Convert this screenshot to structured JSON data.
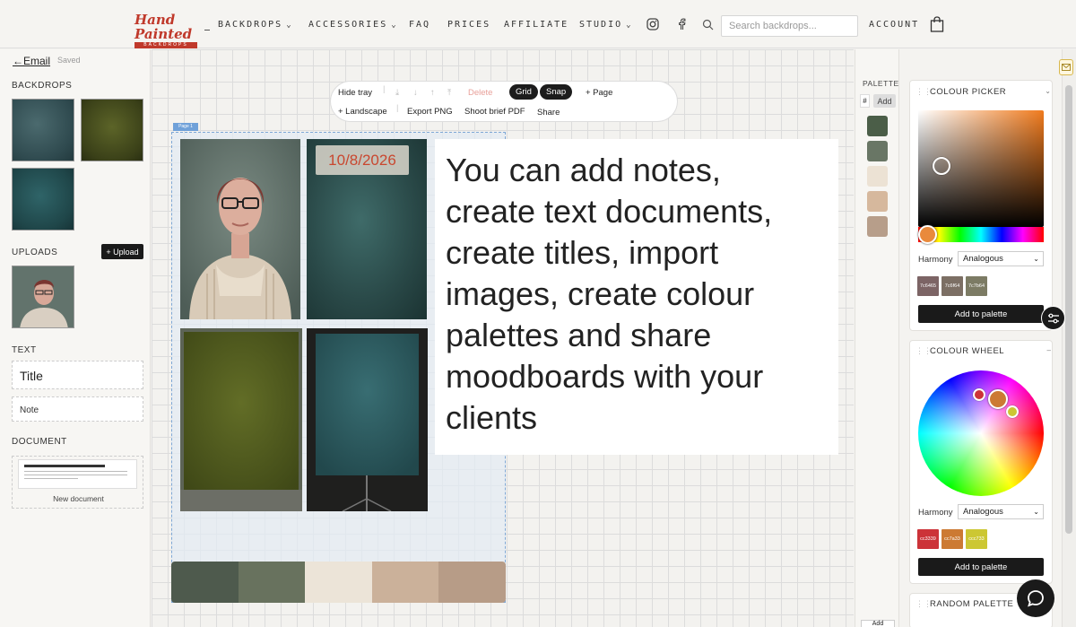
{
  "header": {
    "logo_text": "Hand Painted",
    "logo_sub": "BACKDROPS",
    "nav": [
      {
        "label": "BACKDROPS",
        "dropdown": true
      },
      {
        "label": "ACCESSORIES",
        "dropdown": true
      },
      {
        "label": "FAQ",
        "dropdown": false
      },
      {
        "label": "PRICES",
        "dropdown": false
      },
      {
        "label": "AFFILIATE",
        "dropdown": false
      },
      {
        "label": "STUDIO",
        "dropdown": true
      }
    ],
    "search_placeholder": "Search backdrops...",
    "account_label": "ACCOUNT",
    "icons": [
      "instagram-icon",
      "facebook-icon",
      "search-icon",
      "bag-icon"
    ]
  },
  "sidebar": {
    "back_label": "←Email",
    "saved_label": "Saved",
    "backdrops_label": "BACKDROPS",
    "uploads_label": "UPLOADS",
    "upload_button": "+ Upload",
    "text_label": "TEXT",
    "title_item": "Title",
    "note_item": "Note",
    "document_label": "DOCUMENT",
    "new_document": "New document"
  },
  "tray": {
    "hide_tray": "Hide tray",
    "delete": "Delete",
    "grid": "Grid",
    "snap": "Snap",
    "add_page": "+ Page",
    "landscape": "+ Landscape",
    "export_png": "Export PNG",
    "shoot_brief": "Shoot brief PDF",
    "share": "Share"
  },
  "canvas": {
    "page_tag": "Page 1",
    "date_text": "10/8/2026",
    "note_text": "You can add notes,\ncreate text documents,\ncreate titles, import\nimages, create colour\npalettes and share\nmoodboards with your\nclients",
    "strip_colors": [
      "#4e5a4d",
      "#68725e",
      "#ece4d8",
      "#cbb19a",
      "#b79c87"
    ]
  },
  "palette": {
    "label": "PALETTE",
    "hash_label": "#",
    "add_label": "Add",
    "swatches": [
      "#4b5e48",
      "#697665",
      "#ece2d4",
      "#d6b89d",
      "#b79e8a"
    ],
    "bottom_label": "Add"
  },
  "colour_picker": {
    "title": "COLOUR PICKER",
    "harmony_label": "Harmony",
    "harmony_value": "Analogous",
    "swatches": [
      {
        "hex": "7c6465",
        "color": "#7c6465"
      },
      {
        "hex": "7c6f64",
        "color": "#7c6f64"
      },
      {
        "hex": "7c7b64",
        "color": "#7c7b64"
      }
    ],
    "add_button": "Add to palette",
    "hue": 25
  },
  "colour_wheel": {
    "title": "COLOUR WHEEL",
    "harmony_label": "Harmony",
    "harmony_value": "Analogous",
    "swatches": [
      {
        "hex": "cc3339",
        "color": "#cc3339"
      },
      {
        "hex": "cc7a33",
        "color": "#cc7a33"
      },
      {
        "hex": "ccc733",
        "color": "#ccc733"
      }
    ],
    "add_button": "Add to palette"
  },
  "random_palette": {
    "title": "RANDOM PALETTE"
  }
}
